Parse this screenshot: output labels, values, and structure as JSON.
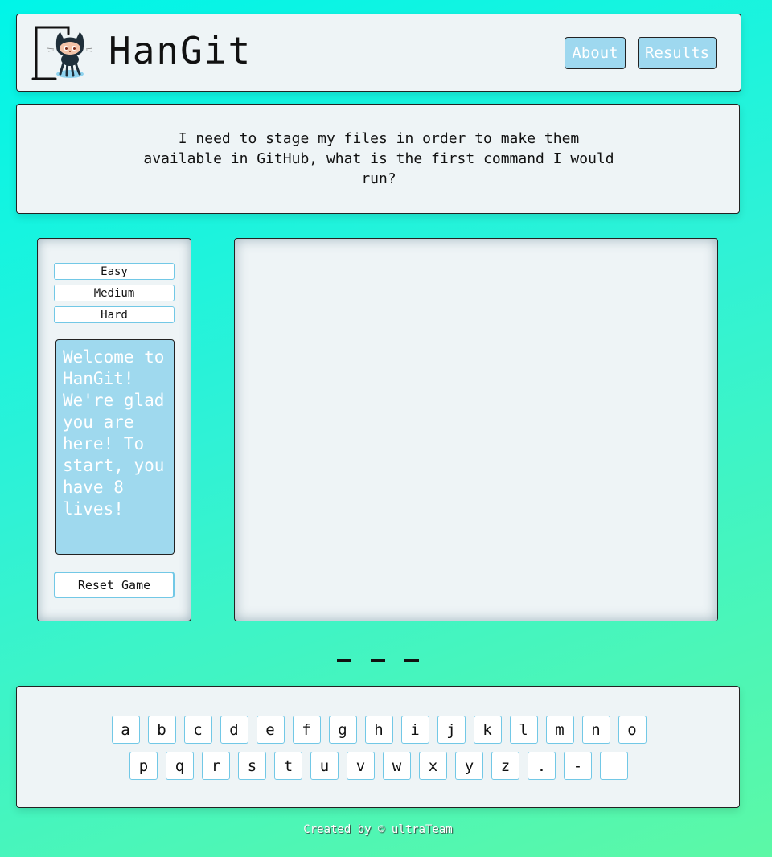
{
  "header": {
    "title": "HanGit",
    "about_label": "About",
    "results_label": "Results",
    "logo_icon": "octocat-hangman-icon"
  },
  "question": {
    "text": "I need to stage my files in order to make them available in GitHub, what is the first command I would run?"
  },
  "sidebar": {
    "difficulty": [
      "Easy",
      "Medium",
      "Hard"
    ],
    "message": "Welcome to HanGit! We're glad you are here! To start, you have 8 lives!",
    "reset_label": "Reset Game"
  },
  "word": {
    "blank_count": 3
  },
  "keyboard": {
    "row1": [
      "a",
      "b",
      "c",
      "d",
      "e",
      "f",
      "g",
      "h",
      "i",
      "j",
      "k",
      "l",
      "m",
      "n",
      "o"
    ],
    "row2": [
      "p",
      "q",
      "r",
      "s",
      "t",
      "u",
      "v",
      "w",
      "x",
      "y",
      "z",
      ".",
      "-",
      " "
    ]
  },
  "footer": {
    "text": "Created by © ultraTeam"
  },
  "colors": {
    "accent": "#9ed8ef",
    "key_border": "#72c8e6",
    "panel": "#eef4f6"
  }
}
